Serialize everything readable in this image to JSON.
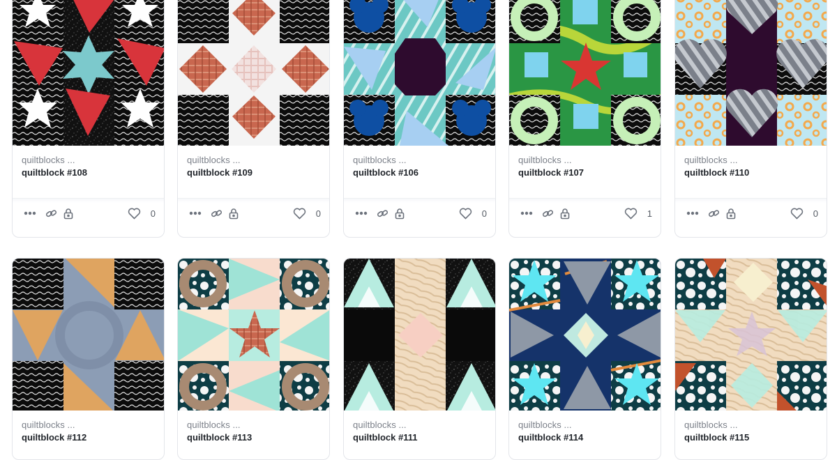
{
  "colors": {
    "card_border": "#e3e5ea",
    "collection_text": "#7a7f88",
    "name_text": "#1f2329",
    "icon": "#6c727c"
  },
  "icons": {
    "more": "more-dots-icon",
    "link": "link-icon",
    "lock": "lock-icon",
    "like": "heart-icon"
  },
  "cards": [
    {
      "collection": "quiltblocks ...",
      "name": "quiltblock #108",
      "likes": "0",
      "thumbnail": "star-quilt-red-triangles"
    },
    {
      "collection": "quiltblocks ...",
      "name": "quiltblock #109",
      "likes": "0",
      "thumbnail": "plaid-diamond-cross"
    },
    {
      "collection": "quiltblocks ...",
      "name": "quiltblock #106",
      "likes": "0",
      "thumbnail": "blue-octagon-pinwheel"
    },
    {
      "collection": "quiltblocks ...",
      "name": "quiltblock #107",
      "likes": "1",
      "thumbnail": "green-rings-red-star"
    },
    {
      "collection": "quiltblocks ...",
      "name": "quiltblock #110",
      "likes": "0",
      "thumbnail": "purple-cross-hearts"
    },
    {
      "collection": "quiltblocks ...",
      "name": "quiltblock #112",
      "thumbnail": "grey-cross-orange-triangles"
    },
    {
      "collection": "quiltblocks ...",
      "name": "quiltblock #113",
      "thumbnail": "brown-rings-plaid-star"
    },
    {
      "collection": "quiltblocks ...",
      "name": "quiltblock #111",
      "thumbnail": "black-diamond-triangles"
    },
    {
      "collection": "quiltblocks ...",
      "name": "quiltblock #114",
      "thumbnail": "navy-cyan-stars"
    },
    {
      "collection": "quiltblocks ...",
      "name": "quiltblock #115",
      "thumbnail": "beige-star-splatter"
    }
  ]
}
